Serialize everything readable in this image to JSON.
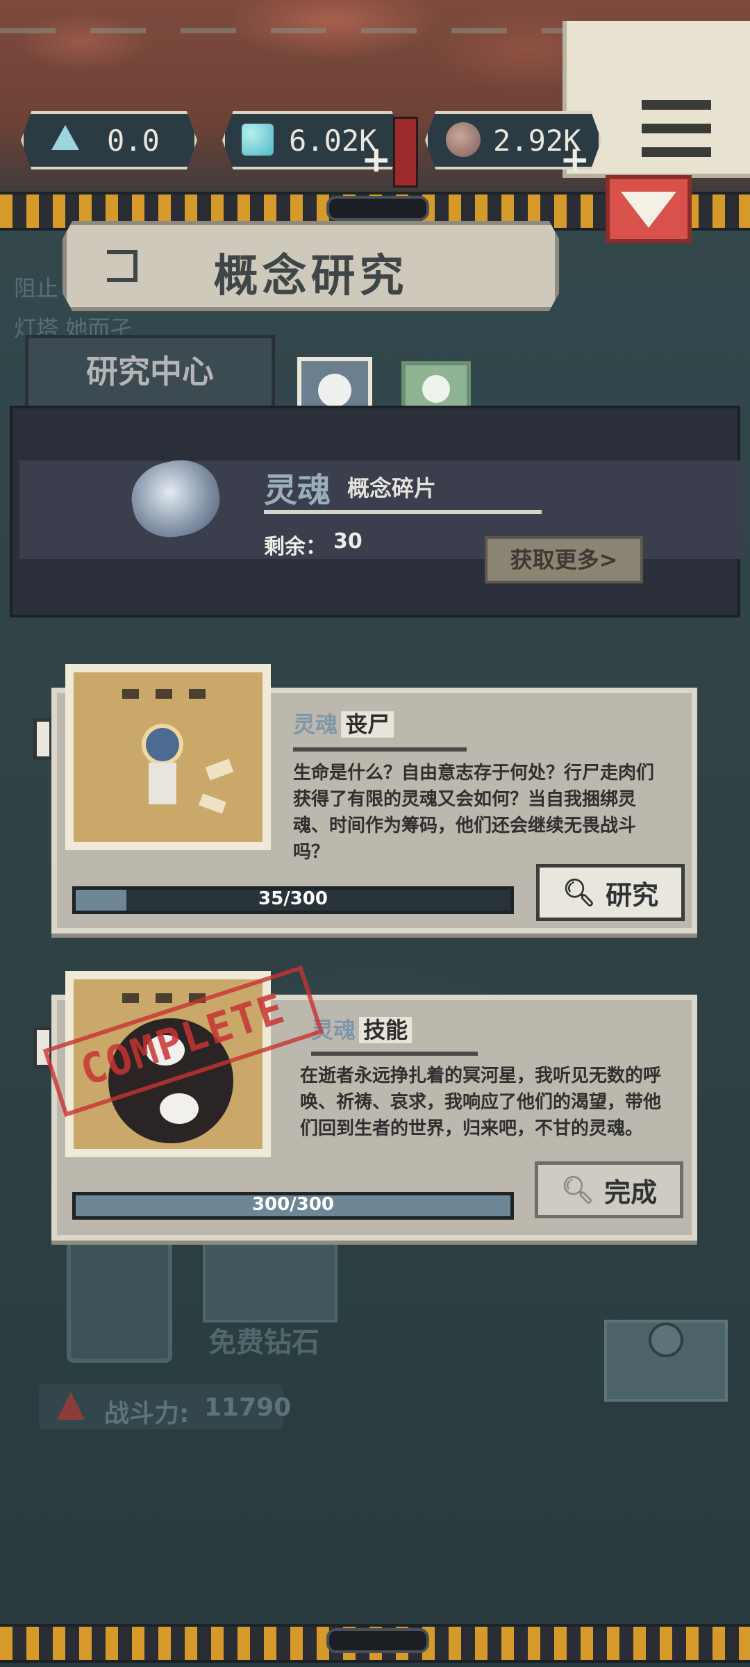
{
  "currency": {
    "crystal": "0.0",
    "gems": "6.02K",
    "ore": "2.92K"
  },
  "title": "概念研究",
  "tabs": {
    "research_center": "研究中心"
  },
  "fragment": {
    "name": "灵魂",
    "subtitle": "概念碎片",
    "remain_label": "剩余：",
    "remain_value": "30",
    "get_more": "获取更多>"
  },
  "cards": [
    {
      "category": "灵魂",
      "name": "丧尸",
      "description": "生命是什么？自由意志存于何处？行尸走肉们获得了有限的灵魂又会如何？当自我捆绑灵魂、时间作为筹码，他们还会继续无畏战斗吗？",
      "progress_text": "35/300",
      "progress_value": 0.1167,
      "action": "研究"
    },
    {
      "category": "灵魂",
      "name": "技能",
      "description": "在逝者永远挣扎着的冥河星，我听见无数的呼唤、祈祷、哀求，我响应了他们的渴望，带他们回到生者的世界，归来吧，不甘的灵魂。",
      "progress_text": "300/300",
      "progress_value": 1.0,
      "action": "完成",
      "stamp": "COMPLETE"
    }
  ],
  "background": {
    "free_diamond": "免费钻石",
    "power_label": "战斗力:",
    "power_value": "11790",
    "side_text_1": "阻止",
    "side_text_2": "灯塔 她而孑"
  },
  "colors": {
    "accent_red": "#d8524b",
    "hazard_yellow": "#d69a2a",
    "progress_fill": "#8fa5b2"
  }
}
